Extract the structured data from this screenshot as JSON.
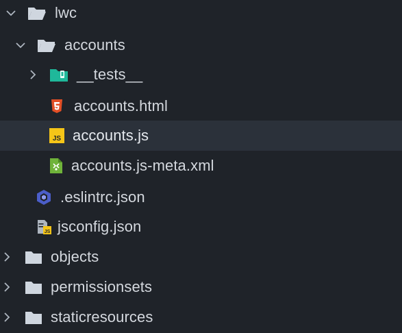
{
  "tree": {
    "lwc": {
      "label": "lwc"
    },
    "accounts": {
      "label": "accounts"
    },
    "tests": {
      "label": "__tests__"
    },
    "accounts_html": {
      "label": "accounts.html"
    },
    "accounts_js": {
      "label": "accounts.js"
    },
    "accounts_meta": {
      "label": "accounts.js-meta.xml"
    },
    "eslintrc": {
      "label": ".eslintrc.json"
    },
    "jsconfig": {
      "label": "jsconfig.json"
    },
    "objects": {
      "label": "objects"
    },
    "permissionsets": {
      "label": "permissionsets"
    },
    "staticresources": {
      "label": "staticresources"
    }
  },
  "colors": {
    "background": "#1f2329",
    "selected_row": "#2b313a",
    "folder": "#cfd6df",
    "tests_folder": "#1fb89a",
    "html": "#e34f26",
    "js": "#f5c518",
    "xml": "#6fb33a",
    "eslint": "#4b5ec9"
  }
}
